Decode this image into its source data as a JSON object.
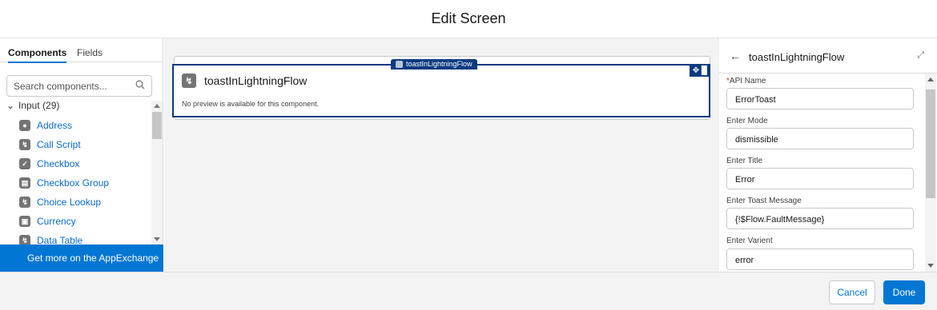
{
  "header": {
    "title": "Edit Screen"
  },
  "left_panel": {
    "tabs": [
      {
        "label": "Components",
        "active": true
      },
      {
        "label": "Fields",
        "active": false
      }
    ],
    "search": {
      "placeholder": "Search components..."
    },
    "group": {
      "label": "Input (29)"
    },
    "components": [
      {
        "label": "Address",
        "icon": "map-pin-icon"
      },
      {
        "label": "Call Script",
        "icon": "lightning-icon"
      },
      {
        "label": "Checkbox",
        "icon": "checkbox-icon"
      },
      {
        "label": "Checkbox Group",
        "icon": "checkbox-group-icon"
      },
      {
        "label": "Choice Lookup",
        "icon": "lightning-icon"
      },
      {
        "label": "Currency",
        "icon": "currency-icon"
      },
      {
        "label": "Data Table",
        "icon": "lightning-icon"
      }
    ],
    "appexchange_label": "Get more on the AppExchange"
  },
  "canvas": {
    "selected_badge": "toastInLightningFlow",
    "component_name": "toastInLightningFlow",
    "preview_text": "No preview is available for this component."
  },
  "properties": {
    "title": "toastInLightningFlow",
    "fields": [
      {
        "label": "API Name",
        "required": true,
        "value": "ErrorToast"
      },
      {
        "label": "Enter Mode",
        "required": false,
        "value": "dismissible"
      },
      {
        "label": "Enter Title",
        "required": false,
        "value": "Error"
      },
      {
        "label": "Enter Toast Message",
        "required": false,
        "value": "{!$Flow.FaultMessage}"
      },
      {
        "label": "Enter Varient",
        "required": false,
        "value": "error"
      }
    ]
  },
  "footer": {
    "cancel_label": "Cancel",
    "done_label": "Done"
  },
  "colors": {
    "brand": "#0176d3",
    "selection": "#0b3a80",
    "link": "#0b6bcb"
  }
}
